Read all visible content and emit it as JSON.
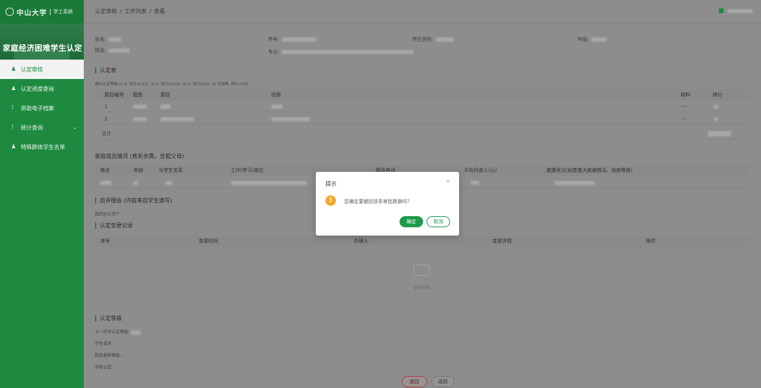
{
  "logo": {
    "text": "中山大学",
    "sub": "学工系统"
  },
  "banner": {
    "title": "家庭经济困难学生认定"
  },
  "nav": {
    "items": [
      {
        "label": "认定审核",
        "icon": "user-icon",
        "active": true
      },
      {
        "label": "认定进度查询",
        "icon": "user-icon"
      },
      {
        "label": "资助电子档案",
        "icon": "chart-icon"
      },
      {
        "label": "统计查询",
        "icon": "chart-icon"
      },
      {
        "label": "特殊群体学生名单",
        "icon": "user-icon"
      }
    ]
  },
  "breadcrumb": {
    "a": "认定审核",
    "b": "工作列表",
    "c": "查看"
  },
  "info": {
    "name_label": "姓名:",
    "studentno_label": "学号:",
    "category_label": "学生类别:",
    "grade_label": "年级:",
    "college_label": "院系:",
    "major_label": "专业:"
  },
  "sections": {
    "form_title": "认定表",
    "hint": "建议认定等级:1) 3, 得分≥15分 ,2) 2, 得分≥10分 ,3) 1, 得分≥5分 ,4) 不困难, 得分<5分",
    "family_title": "家庭成员情况 (直系亲属，含祖父母)",
    "reason_title": "自评理由 (内容来自学生填写)",
    "reason_text": "我的分公司个",
    "change_title": "认定变更记录",
    "level_title": "认定等级"
  },
  "form_table": {
    "headers": [
      "题目编号",
      "题型",
      "题目",
      "回答",
      "材料",
      "得分"
    ],
    "rows": [
      {
        "no": "1",
        "material": "---"
      },
      {
        "no": "2",
        "material": "---"
      }
    ],
    "total_label": "合计"
  },
  "family_table": {
    "headers": [
      "姓名",
      "年龄",
      "与学生关系",
      "工作(学习)单位",
      "联系电话",
      "平均月收入(元)",
      "健康状况(如患重大疾病情况、残疾等级)"
    ]
  },
  "change_table": {
    "headers": [
      "序号",
      "变更时间",
      "办理人",
      "变更详情",
      "附件"
    ],
    "empty_text": "暂无数据"
  },
  "levels": {
    "prev": "上一学年认定等级:",
    "self": "学生自评:",
    "college": "院系推荐等级: -",
    "school": "学校认定: -"
  },
  "buttons": {
    "withdraw": "撤回",
    "back": "返回"
  },
  "dialog": {
    "title": "提示",
    "message": "您确定要撤回该条审批数据吗？",
    "ok": "确定",
    "cancel": "取消"
  },
  "colors": {
    "brand": "#1e8a3f",
    "warning": "#f5a623",
    "danger": "#b33c3c"
  }
}
